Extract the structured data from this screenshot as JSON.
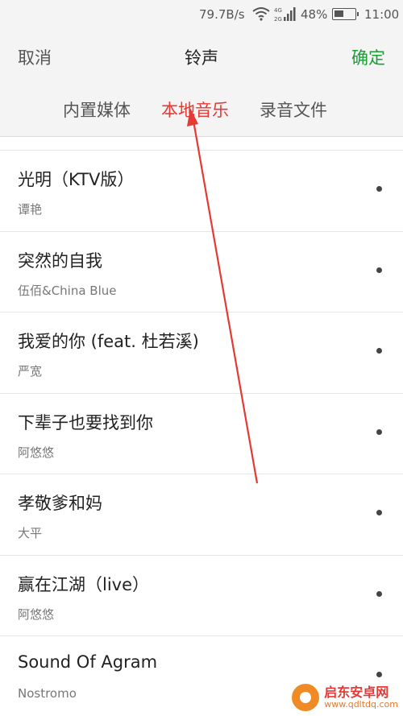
{
  "status_bar": {
    "speed": "79.7B/s",
    "signal_label": "4G 2G",
    "battery_percent": "48%",
    "battery_level": 0.48,
    "time": "11:00"
  },
  "header": {
    "cancel_label": "取消",
    "title": "铃声",
    "confirm_label": "确定"
  },
  "tabs": [
    {
      "label": "内置媒体"
    },
    {
      "label": "本地音乐",
      "active": true
    },
    {
      "label": "录音文件"
    }
  ],
  "songs": [
    {
      "title": "光明（KTV版）",
      "artist": "谭艳"
    },
    {
      "title": "突然的自我",
      "artist": "伍佰&China Blue"
    },
    {
      "title": "我爱的你 (feat. 杜若溪)",
      "artist": "严宽"
    },
    {
      "title": "下辈子也要找到你",
      "artist": "阿悠悠"
    },
    {
      "title": "孝敬爹和妈",
      "artist": "大平"
    },
    {
      "title": "赢在江湖（live）",
      "artist": "阿悠悠"
    },
    {
      "title": "Sound Of Agram",
      "artist": "Nostromo"
    }
  ],
  "annotation": {
    "color": "#e53935"
  },
  "watermark": {
    "name": "启东安卓网",
    "url": "www.qdltdq.com"
  },
  "colors": {
    "accent_red": "#e53935",
    "confirm_green": "#18a033"
  }
}
